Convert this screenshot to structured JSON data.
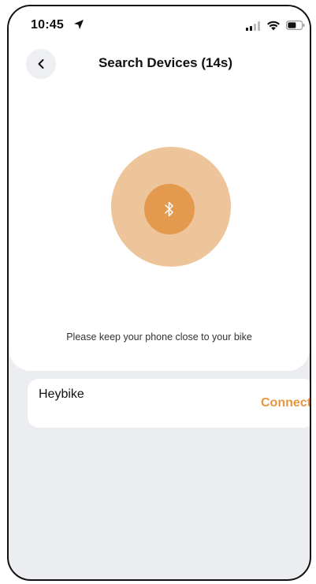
{
  "status_bar": {
    "time": "10:45"
  },
  "header": {
    "title": "Search Devices (14s)"
  },
  "search": {
    "hint": "Please keep your phone close to your bike"
  },
  "devices": [
    {
      "name": "Heybike",
      "action_label": "Connect"
    }
  ],
  "colors": {
    "accent": "#e8963e",
    "radar_outer": "#eec59a",
    "radar_inner": "#e49a4e",
    "background": "#ecedf1"
  },
  "icons": {
    "back": "chevron-left-icon",
    "bluetooth": "bluetooth-icon",
    "location": "location-arrow-icon",
    "signal": "cellular-signal-icon",
    "wifi": "wifi-icon",
    "battery": "battery-icon"
  }
}
